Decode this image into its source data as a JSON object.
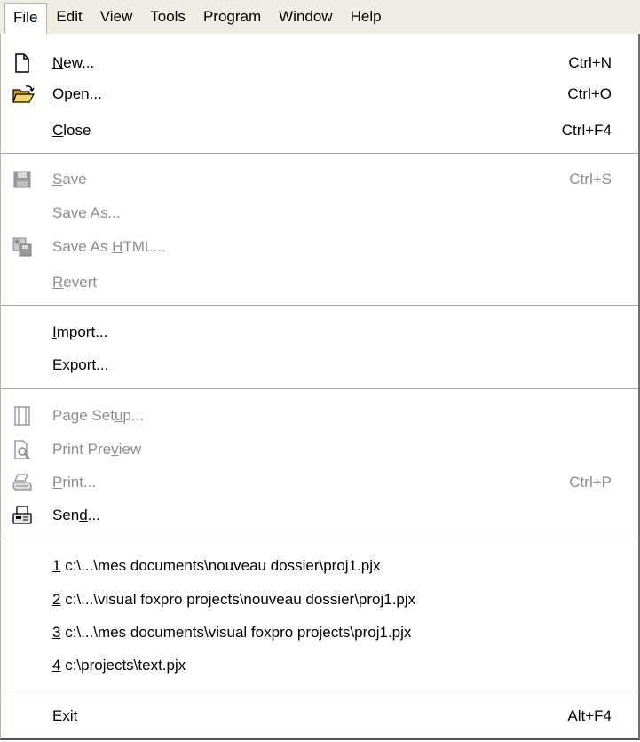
{
  "menubar": {
    "items": [
      "File",
      "Edit",
      "View",
      "Tools",
      "Program",
      "Window",
      "Help"
    ]
  },
  "file_menu": {
    "new": {
      "pre": "",
      "mnem": "N",
      "post": "ew...",
      "shortcut": "Ctrl+N"
    },
    "open": {
      "pre": "",
      "mnem": "O",
      "post": "pen...",
      "shortcut": "Ctrl+O"
    },
    "close": {
      "pre": "",
      "mnem": "C",
      "post": "lose",
      "shortcut": "Ctrl+F4"
    },
    "save": {
      "pre": "",
      "mnem": "S",
      "post": "ave",
      "shortcut": "Ctrl+S"
    },
    "save_as": {
      "pre": "Save ",
      "mnem": "A",
      "post": "s..."
    },
    "save_as_html": {
      "pre": "Save As ",
      "mnem": "H",
      "post": "TML..."
    },
    "revert": {
      "pre": "",
      "mnem": "R",
      "post": "evert"
    },
    "import": {
      "pre": "",
      "mnem": "I",
      "post": "mport..."
    },
    "export": {
      "pre": "",
      "mnem": "E",
      "post": "xport..."
    },
    "page_setup": {
      "pre": "Page Set",
      "mnem": "u",
      "post": "p..."
    },
    "print_preview": {
      "pre": "Print Pre",
      "mnem": "v",
      "post": "iew"
    },
    "print": {
      "pre": "",
      "mnem": "P",
      "post": "rint...",
      "shortcut": "Ctrl+P"
    },
    "send": {
      "pre": "Sen",
      "mnem": "d",
      "post": "..."
    },
    "recent": [
      {
        "mnem": "1",
        "path": " c:\\...\\mes documents\\nouveau dossier\\proj1.pjx"
      },
      {
        "mnem": "2",
        "path": " c:\\...\\visual foxpro projects\\nouveau dossier\\proj1.pjx"
      },
      {
        "mnem": "3",
        "path": " c:\\...\\mes documents\\visual foxpro projects\\proj1.pjx"
      },
      {
        "mnem": "4",
        "path": " c:\\projects\\text.pjx"
      }
    ],
    "exit": {
      "pre": "E",
      "mnem": "x",
      "post": "it",
      "shortcut": "Alt+F4"
    }
  },
  "icons": {
    "new": "new-document-icon",
    "open": "open-folder-icon",
    "save": "floppy-disk-icon",
    "save_as_html": "save-html-icon",
    "page_setup": "page-setup-icon",
    "print_preview": "print-preview-icon",
    "print": "printer-icon",
    "send": "send-icon"
  },
  "colors": {
    "menubar_bg": "#f0ede4",
    "disabled_text": "#8d8d8d",
    "separator": "#a8a8a8"
  }
}
